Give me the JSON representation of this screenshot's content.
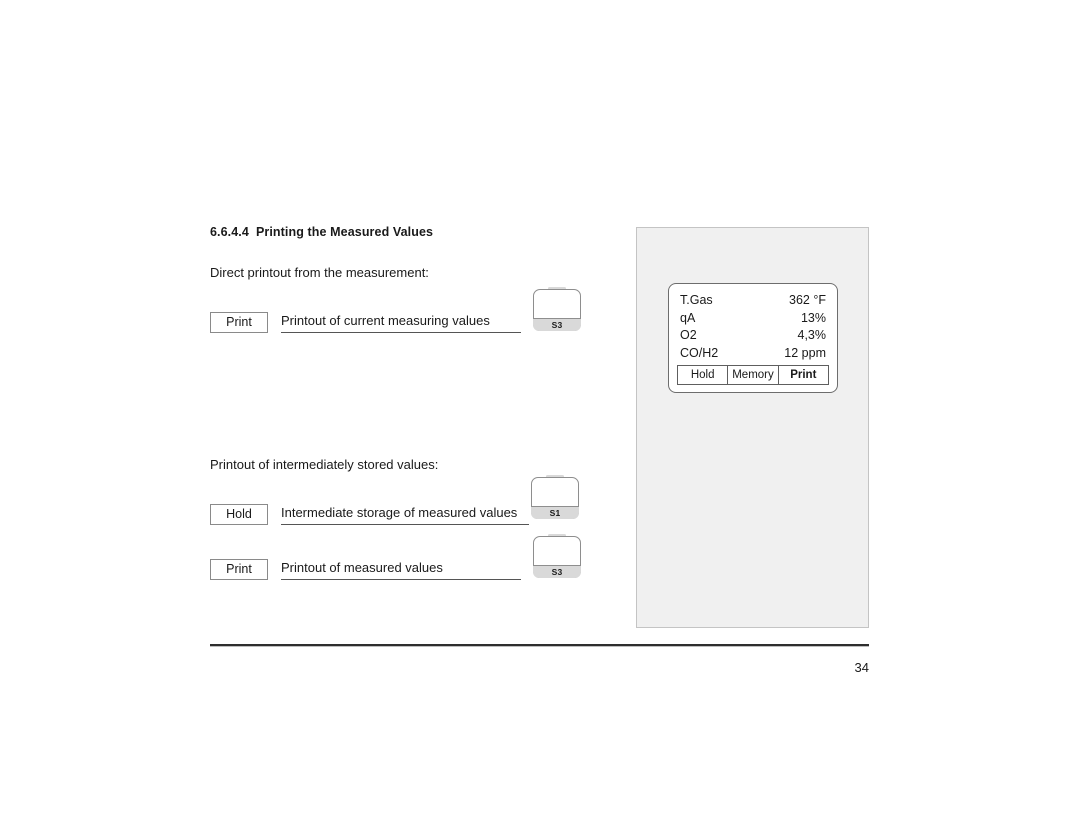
{
  "document": {
    "heading_number": "6.6.4.4",
    "heading_title": "Printing the Measured Values",
    "page_number": "34"
  },
  "sections": {
    "direct": {
      "intro": "Direct printout from the measurement:",
      "rows": [
        {
          "button_label": "Print",
          "description": "Printout of current measuring values",
          "hardware_key": "S3"
        }
      ]
    },
    "stored": {
      "intro": "Printout of intermediately stored values:",
      "rows": [
        {
          "button_label": "Hold",
          "description": "Intermediate storage of measured values",
          "hardware_key": "S1"
        },
        {
          "button_label": "Print",
          "description": "Printout of measured values",
          "hardware_key": "S3"
        }
      ]
    }
  },
  "device_display": {
    "readouts": [
      {
        "label": "T.Gas",
        "value": "362 °F"
      },
      {
        "label": "qA",
        "value": "13%"
      },
      {
        "label": "O2",
        "value": "4,3%"
      },
      {
        "label": "CO/H2",
        "value": "12 ppm"
      }
    ],
    "softkeys": [
      {
        "label": "Hold",
        "active": false
      },
      {
        "label": "Memory",
        "active": false
      },
      {
        "label": "Print",
        "active": true
      }
    ]
  }
}
